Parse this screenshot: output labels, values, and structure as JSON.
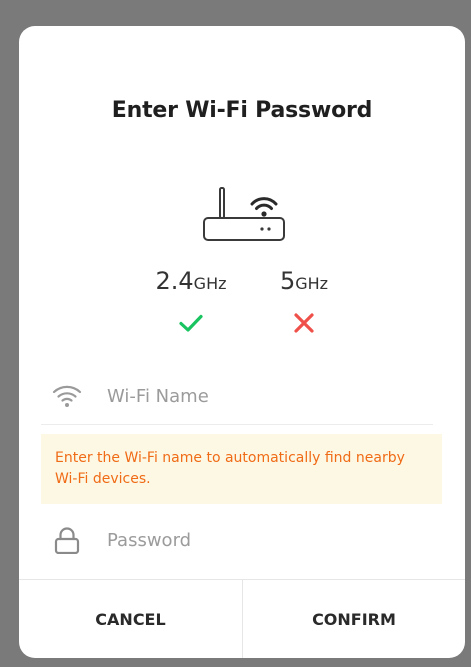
{
  "dialog": {
    "title": "Enter Wi-Fi Password",
    "router_icon": "router-icon",
    "bands": [
      {
        "value": "2.4",
        "unit": "GHz",
        "supported": true,
        "status_icon": "check-icon",
        "color": "#19c460"
      },
      {
        "value": "5",
        "unit": "GHz",
        "supported": false,
        "status_icon": "cross-icon",
        "color": "#f0504a"
      }
    ],
    "wifi_field": {
      "icon": "wifi-icon",
      "placeholder": "Wi-Fi Name",
      "value": ""
    },
    "hint": "Enter the Wi-Fi name to automatically find nearby Wi-Fi devices.",
    "password_field": {
      "icon": "lock-icon",
      "placeholder": "Password",
      "value": ""
    },
    "buttons": {
      "cancel": "CANCEL",
      "confirm": "CONFIRM"
    }
  },
  "colors": {
    "overlay": "#7a7a7a",
    "hint_background": "#fdf8e4",
    "hint_text": "#f06b16",
    "check": "#19c460",
    "cross": "#f0504a"
  }
}
